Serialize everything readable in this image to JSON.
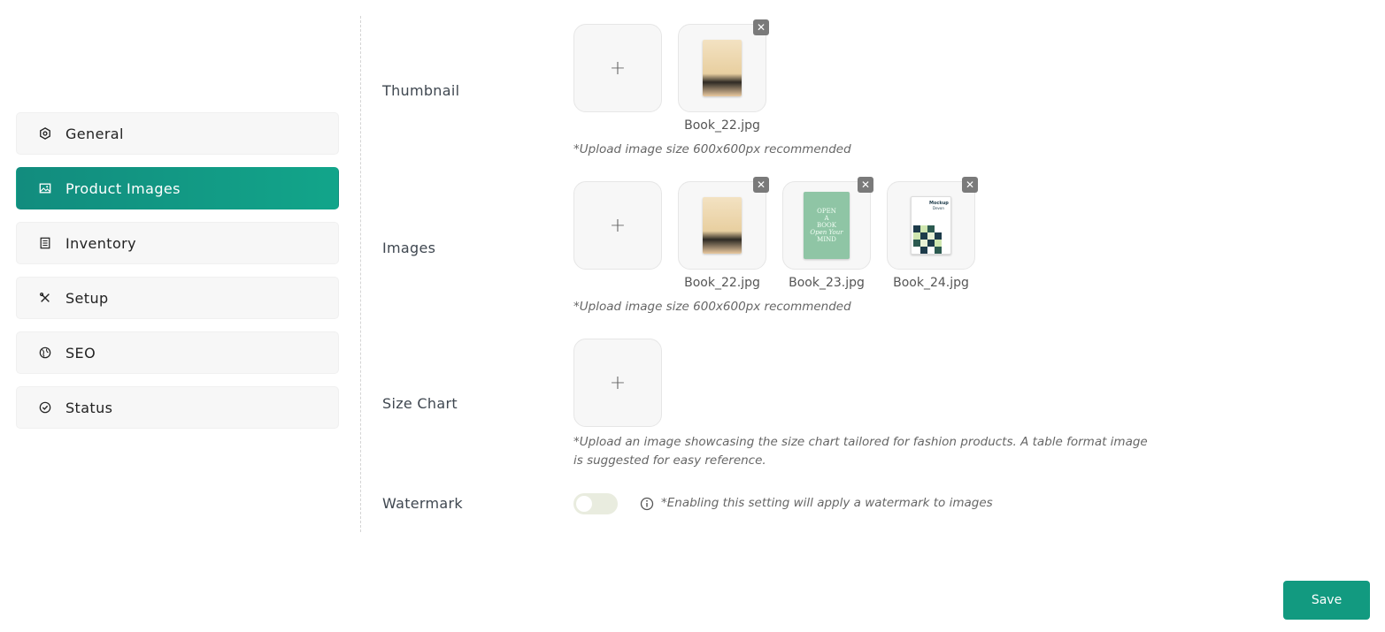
{
  "sidebar": {
    "items": [
      {
        "label": "General",
        "icon": "hexagon-icon",
        "active": false
      },
      {
        "label": "Product Images",
        "icon": "image-icon",
        "active": true
      },
      {
        "label": "Inventory",
        "icon": "list-icon",
        "active": false
      },
      {
        "label": "Setup",
        "icon": "tools-icon",
        "active": false
      },
      {
        "label": "SEO",
        "icon": "globe-icon",
        "active": false
      },
      {
        "label": "Status",
        "icon": "check-circle-icon",
        "active": false
      }
    ]
  },
  "form": {
    "thumbnail": {
      "label": "Thumbnail",
      "add_symbol": "+",
      "files": [
        "Book_22.jpg"
      ],
      "hint": "*Upload image size 600x600px recommended"
    },
    "images": {
      "label": "Images",
      "add_symbol": "+",
      "files": [
        "Book_22.jpg",
        "Book_23.jpg",
        "Book_24.jpg"
      ],
      "hint": "*Upload image size 600x600px recommended"
    },
    "size_chart": {
      "label": "Size Chart",
      "add_symbol": "+",
      "hint_line1": "*Upload an image showcasing the size chart tailored for fashion products. A table format image",
      "hint_line2": "is suggested for easy reference."
    },
    "watermark": {
      "label": "Watermark",
      "enabled": false,
      "hint": "*Enabling this setting will apply a watermark to images"
    }
  },
  "remove_symbol": "✕",
  "save_label": "Save",
  "colors": {
    "accent": "#129a80"
  }
}
